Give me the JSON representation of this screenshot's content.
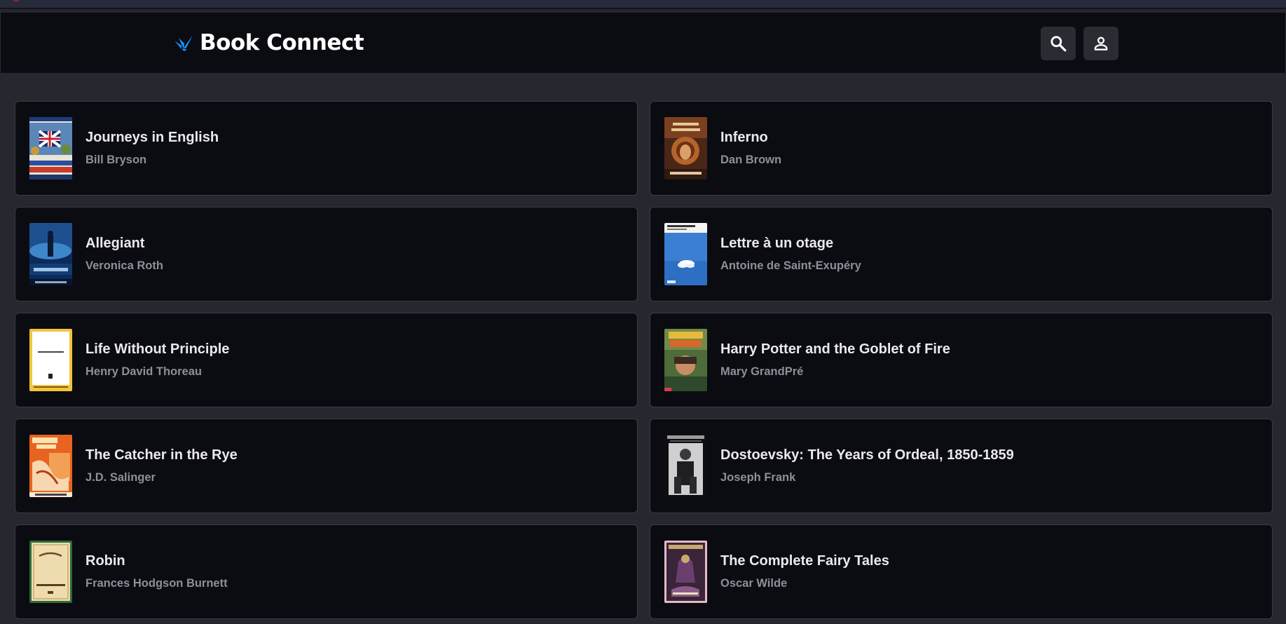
{
  "app": {
    "title": "Book Connect"
  },
  "header": {
    "search_icon": "search-icon",
    "account_icon": "person-icon"
  },
  "colors": {
    "page_bg": "#26272f",
    "card_bg": "#0b0b12",
    "accent": "#1e90ff",
    "title_text": "#e9e9ee",
    "author_text": "#8e8f98"
  },
  "books": [
    {
      "title": "Journeys in English",
      "author": "Bill Bryson"
    },
    {
      "title": "Inferno",
      "author": "Dan Brown"
    },
    {
      "title": "Allegiant",
      "author": "Veronica Roth"
    },
    {
      "title": "Lettre à un otage",
      "author": "Antoine de Saint-Exupéry"
    },
    {
      "title": "Life Without Principle",
      "author": "Henry David Thoreau"
    },
    {
      "title": "Harry Potter and the Goblet of Fire",
      "author": "Mary GrandPré"
    },
    {
      "title": "The Catcher in the Rye",
      "author": "J.D. Salinger"
    },
    {
      "title": "Dostoevsky: The Years of Ordeal, 1850-1859",
      "author": "Joseph Frank"
    },
    {
      "title": "Robin",
      "author": "Frances Hodgson Burnett"
    },
    {
      "title": "The Complete Fairy Tales",
      "author": "Oscar Wilde"
    }
  ]
}
